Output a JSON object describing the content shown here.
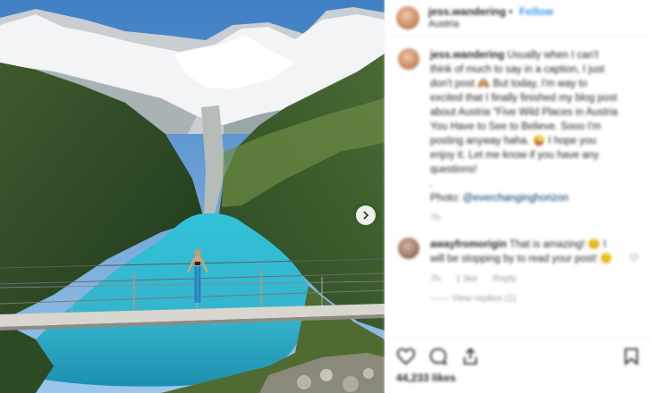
{
  "media": {
    "next_icon": "chevron-right-icon",
    "alt": "Woman standing on suspension bridge above turquoise alpine lake"
  },
  "header": {
    "username": "jess.wandering",
    "follow_label": "Follow",
    "location": "Austria",
    "avatar_icon": "avatar"
  },
  "caption": {
    "username": "jess.wandering",
    "text": "Usually when I can't think of much to say in a caption, I just don't post 🙈 But today, I'm way to excited that I finally finished my blog post about Austria \"Five Wild Places in Austria You Have to See to Believe. Sooo I'm posting anyway haha. 😜 I hope you enjoy it. Let me know if you have any questions!",
    "dot": ".",
    "photo_label": "Photo:",
    "photo_handle": "@everchanginghorizon",
    "time": "7h"
  },
  "comment": {
    "username": "awayfromorigin",
    "text": "That is amazing! 😊 I will be stopping by to read your post! 🙂",
    "time": "7h",
    "likes": "1 like",
    "reply_label": "Reply",
    "view_replies": "——  View replies (1)"
  },
  "actions": {
    "like_icon": "heart-icon",
    "comment_icon": "comment-icon",
    "share_icon": "share-icon",
    "save_icon": "bookmark-icon",
    "likes_count": "44,233 likes"
  }
}
